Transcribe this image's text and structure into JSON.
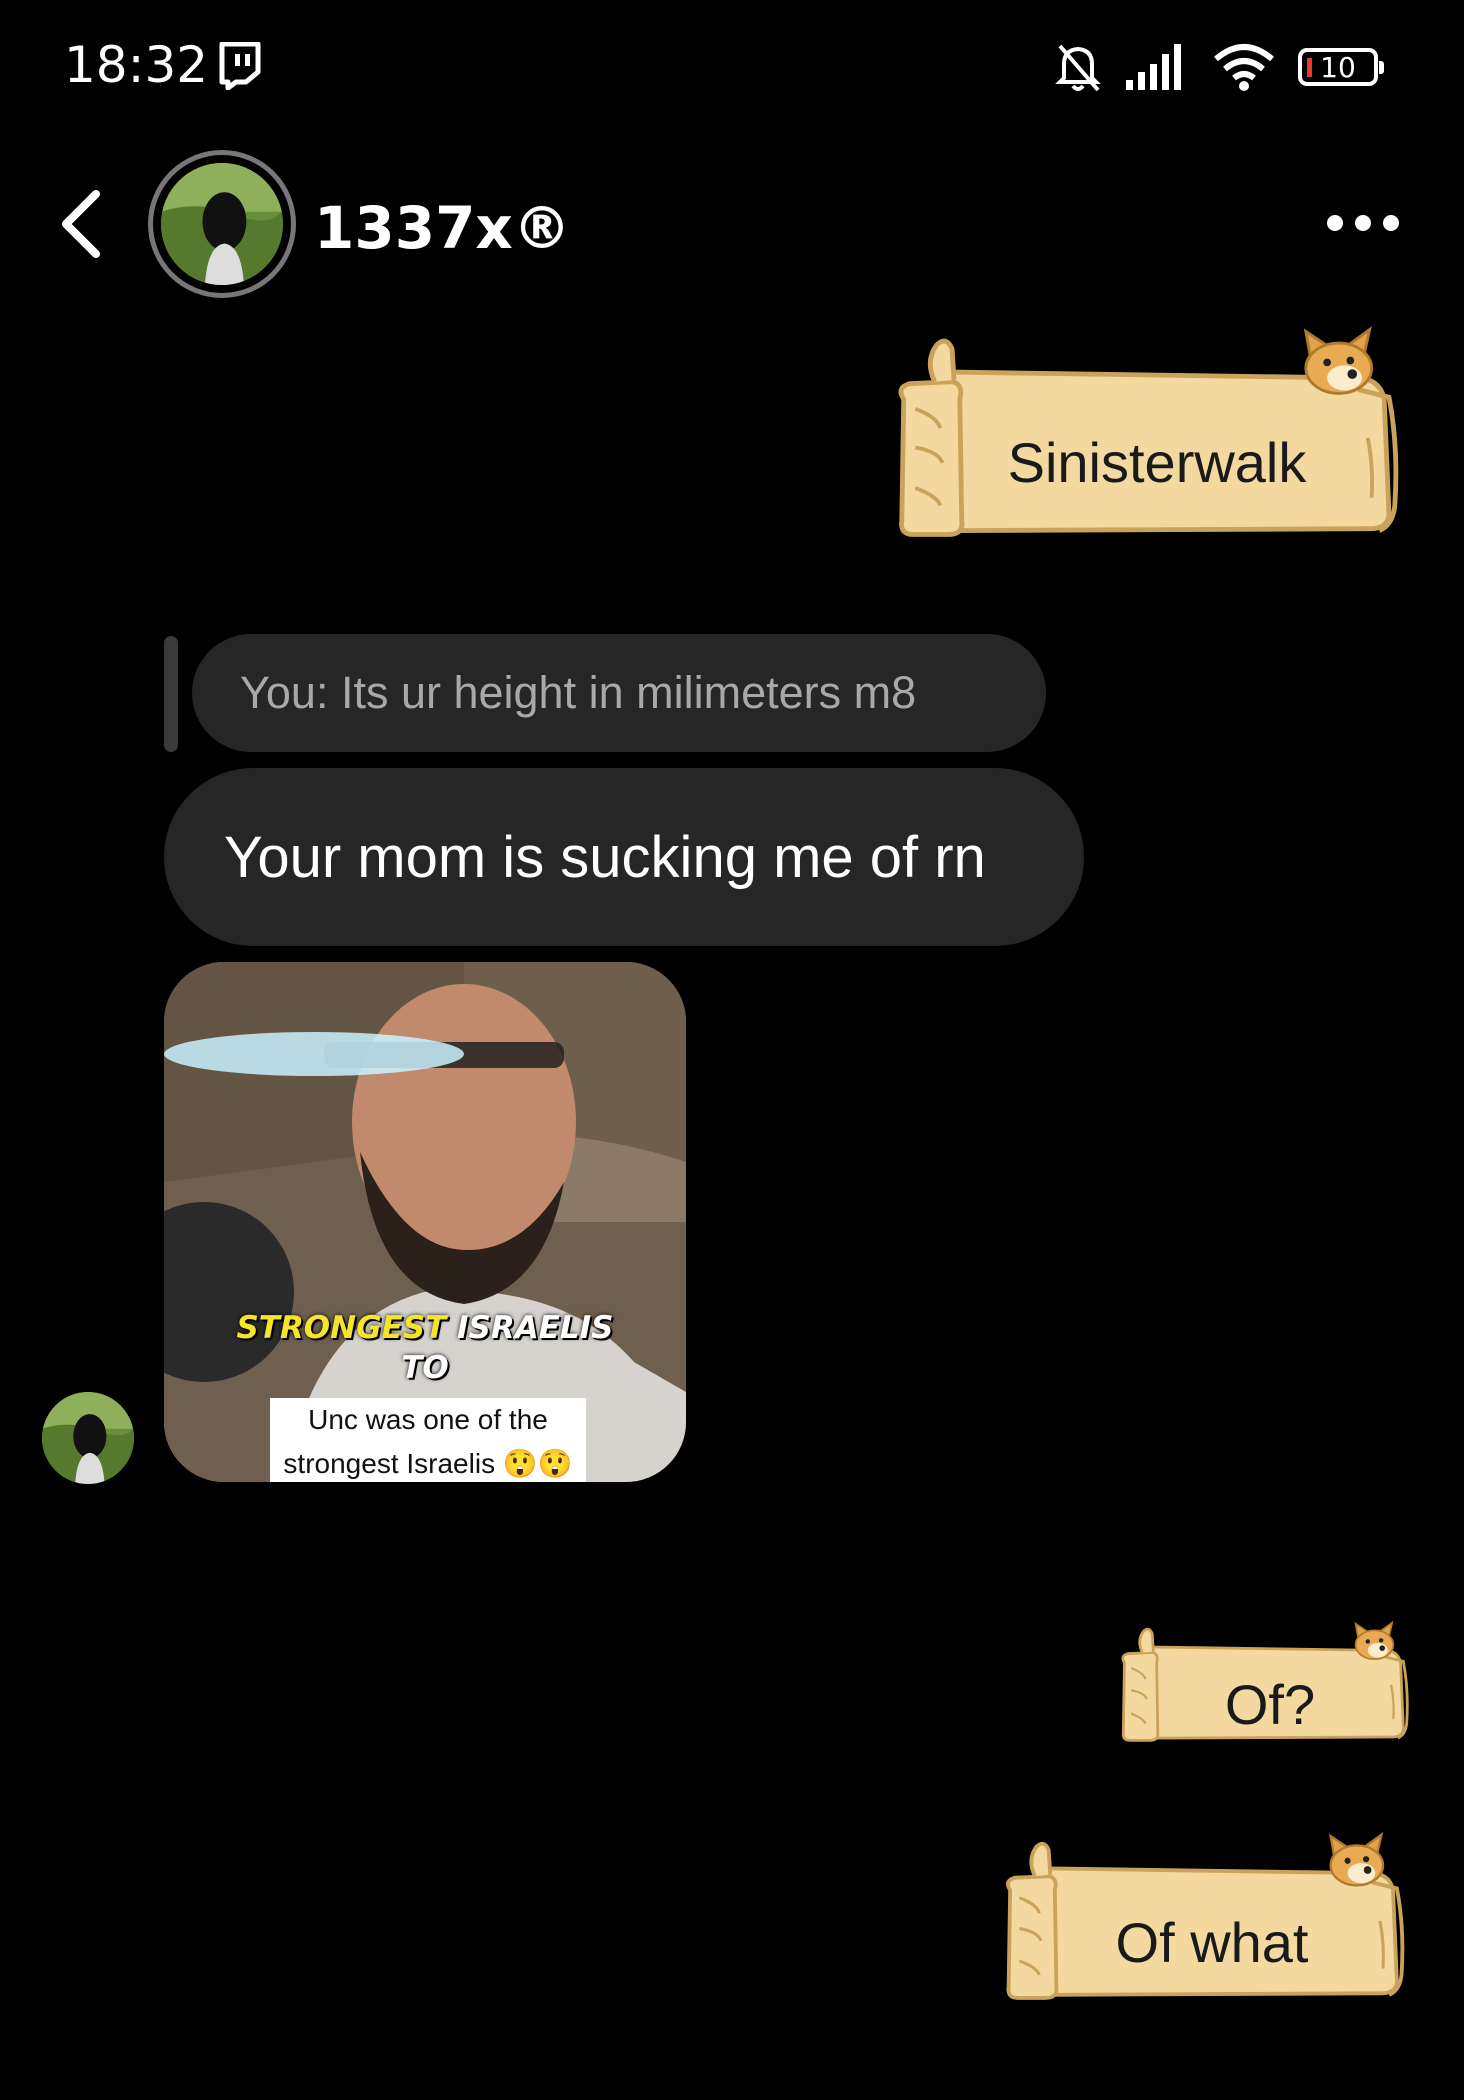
{
  "status_bar": {
    "time": "18:32",
    "battery_level": "10",
    "icons": [
      "twitch-icon",
      "notifications-muted-icon",
      "signal-icon",
      "wifi-icon",
      "battery-icon"
    ]
  },
  "header": {
    "contact_name": "1337x®",
    "back_icon": "chevron-left-icon",
    "menu_icon": "more-dots-icon"
  },
  "messages": [
    {
      "direction": "outgoing",
      "style": "doge-scroll",
      "text": "Sinisterwalk"
    },
    {
      "direction": "incoming",
      "reply_to": "You: Its ur height in milimeters m8",
      "text": "Your mom is sucking me of rn"
    },
    {
      "direction": "incoming",
      "type": "video",
      "caption_yellow": "STRONGEST",
      "caption_white": "ISRAELIS",
      "caption_line2": "TO",
      "subtitle_line1": "Unc was one of the",
      "subtitle_line2": "strongest Israelis 😲😲"
    },
    {
      "direction": "outgoing",
      "style": "doge-scroll",
      "text": "Of?"
    },
    {
      "direction": "outgoing",
      "style": "doge-scroll",
      "text": "Of what"
    }
  ],
  "colors": {
    "background": "#000000",
    "incoming_bubble": "#262626",
    "scroll_paper": "#f3d9a0",
    "scroll_outline": "#caa35a"
  }
}
